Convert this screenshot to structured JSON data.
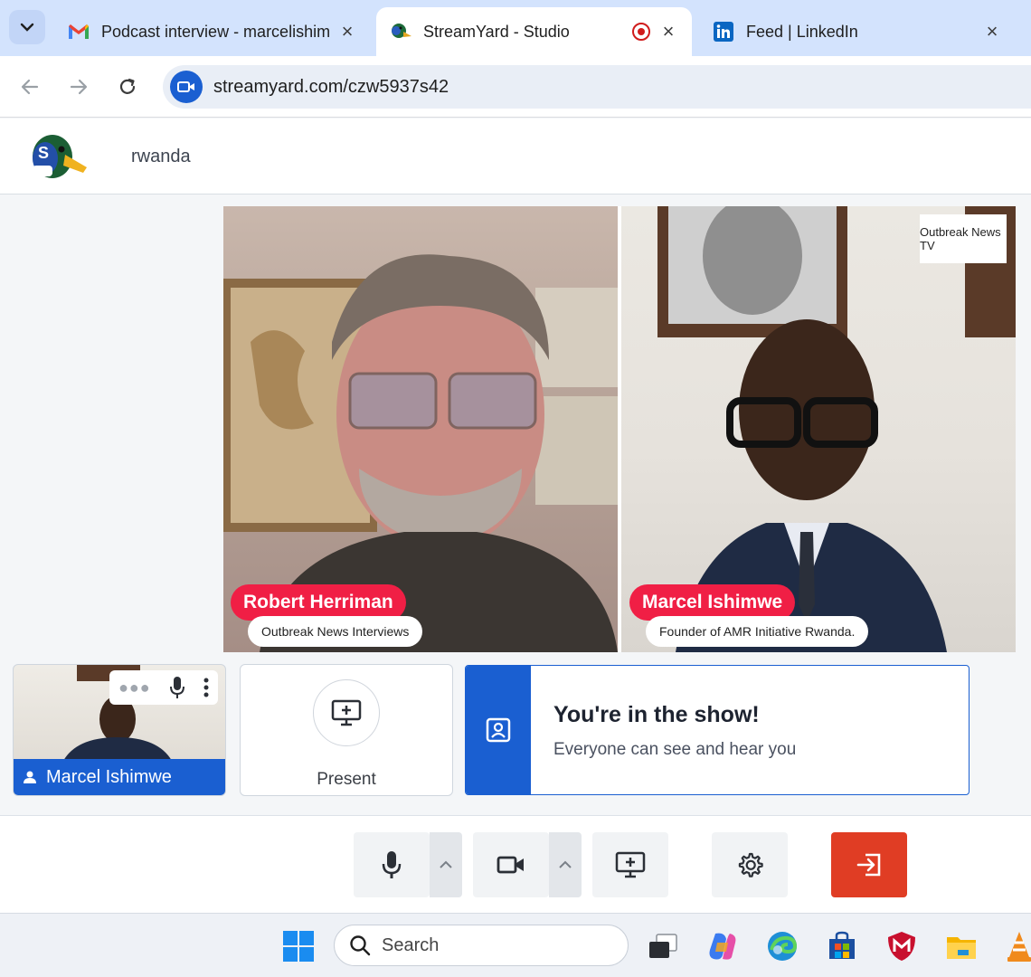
{
  "browser": {
    "tabs": [
      {
        "title": "Podcast interview - marcelishim",
        "favicon": "gmail-icon"
      },
      {
        "title": "StreamYard - Studio",
        "favicon": "streamyard-icon",
        "recording": true
      },
      {
        "title": "Feed | LinkedIn",
        "favicon": "linkedin-icon"
      }
    ],
    "url": "streamyard.com/czw5937s42"
  },
  "studio": {
    "broadcast_name": "rwanda",
    "stage": {
      "participants": [
        {
          "name": "Robert Herriman",
          "title": "Outbreak News Interviews"
        },
        {
          "name": "Marcel Ishimwe",
          "title": "Founder of AMR Initiative Rwanda."
        }
      ],
      "brand_logo_text": "Outbreak News TV"
    },
    "self_tile": {
      "name": "Marcel Ishimwe"
    },
    "present": {
      "label": "Present"
    },
    "banner": {
      "title": "You're in the show!",
      "subtitle": "Everyone can see and hear you"
    },
    "colors": {
      "accent": "#1a5fd1",
      "name_tag": "#f01f45",
      "leave": "#e03d24"
    }
  },
  "taskbar": {
    "search_placeholder": "Search"
  }
}
